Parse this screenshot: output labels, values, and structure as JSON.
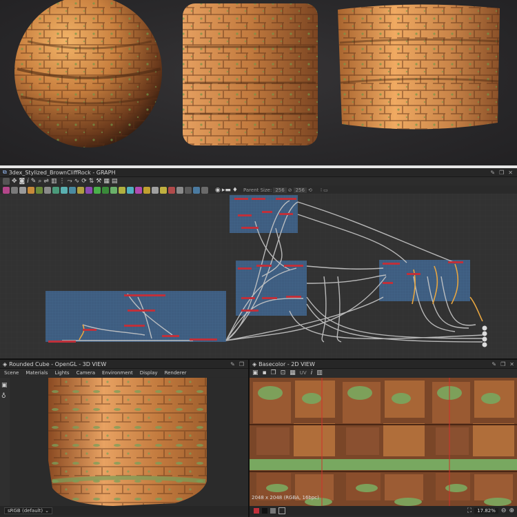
{
  "graph_panel": {
    "title": "3dex_Stylized_BrownCliffRock - GRAPH",
    "parent_size_label": "Parent Size:",
    "parent_size_value_1": "256",
    "parent_size_value_2": "256"
  },
  "view3d": {
    "title": "Rounded Cube - OpenGL - 3D VIEW",
    "menu": [
      "Scene",
      "Materials",
      "Lights",
      "Camera",
      "Environment",
      "Display",
      "Renderer"
    ],
    "colorspace": "sRGB (default)"
  },
  "view2d": {
    "title": "Basecolor - 2D VIEW",
    "uv_label": "UV",
    "info": "2048 x 2048 (RGBA, 16bpc)",
    "zoom": "17.82%"
  },
  "colors": {
    "frame_blue": "#3e5d80",
    "node_red": "#c0303a",
    "wire": "#c8c8c8",
    "wire_orange": "#e8a640",
    "rock": "#c27a3e",
    "moss": "#78a05a"
  }
}
